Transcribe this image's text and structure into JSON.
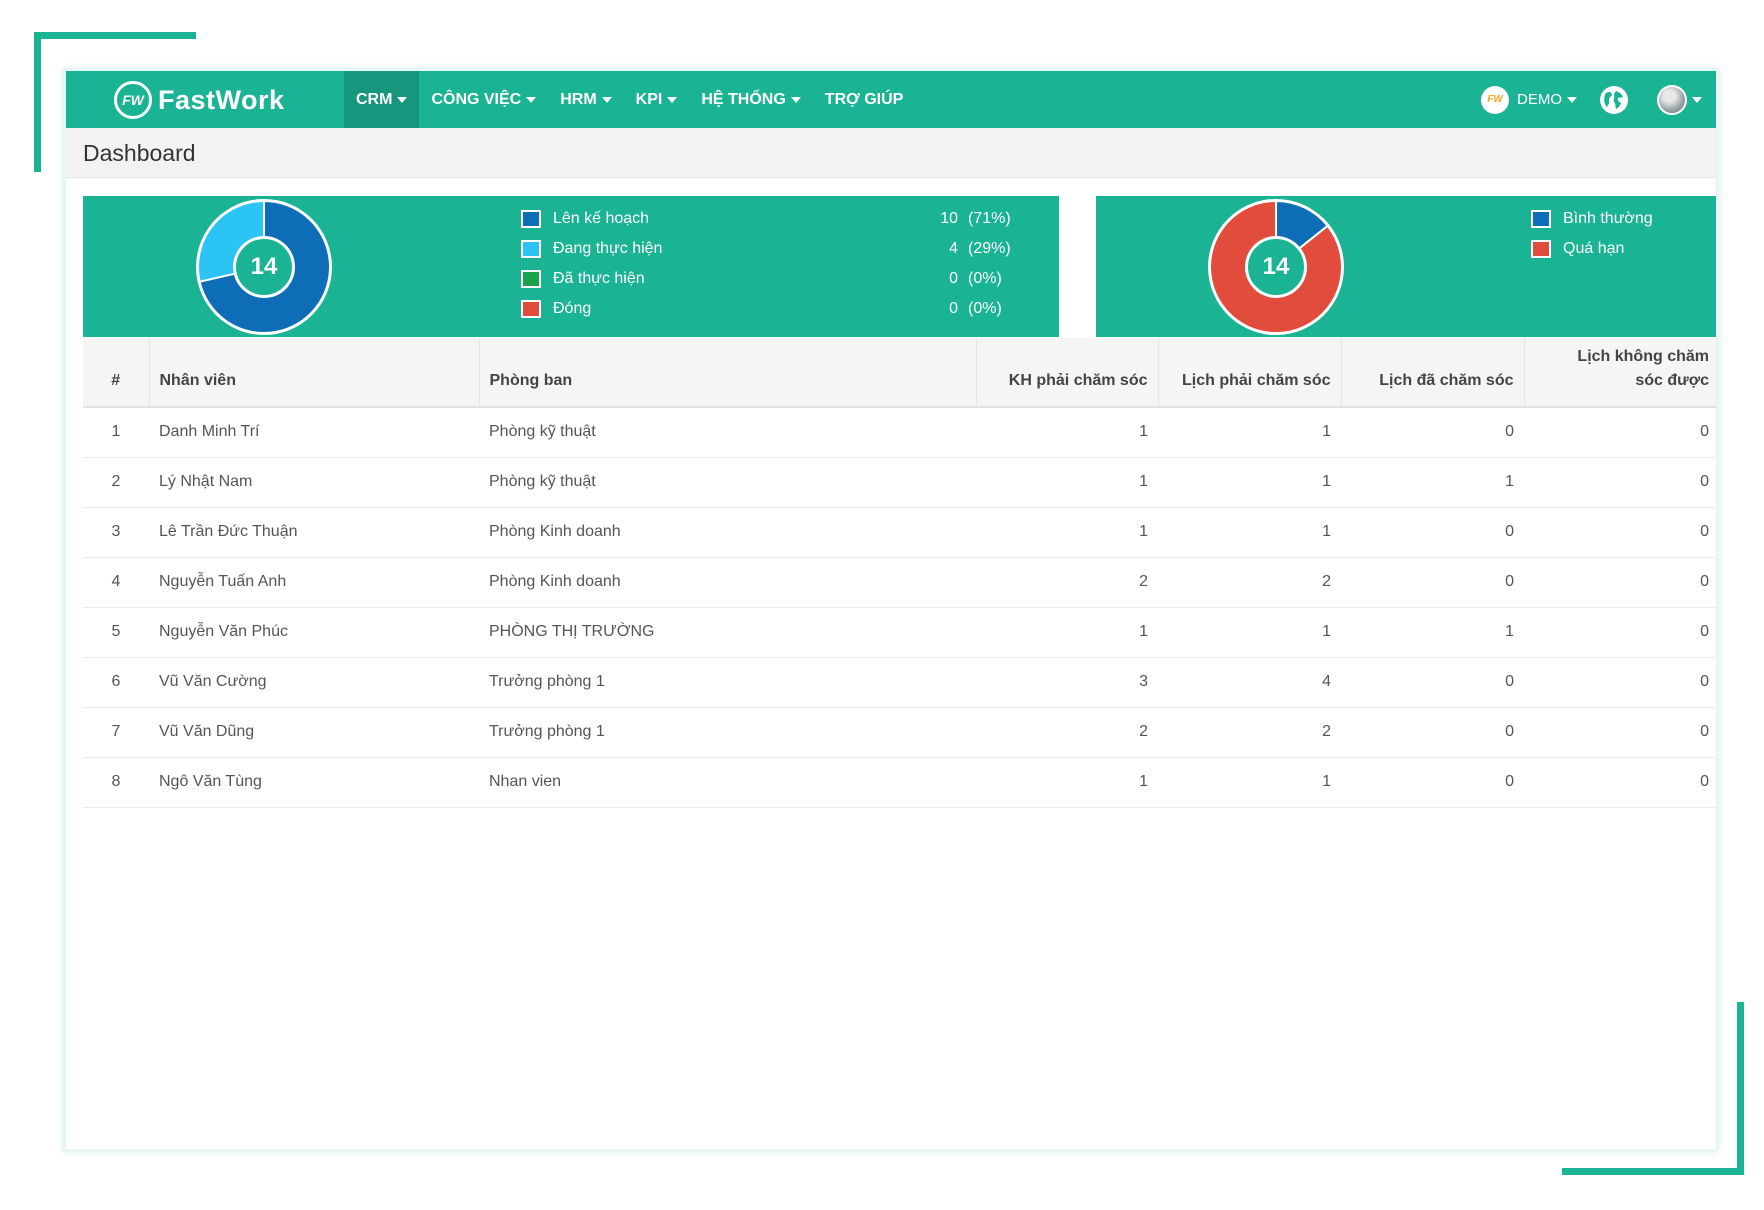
{
  "brand": {
    "logo_text": "FW",
    "name": "FastWork"
  },
  "menu": [
    {
      "label": "CRM",
      "dropdown": true,
      "active": true
    },
    {
      "label": "CÔNG VIỆC",
      "dropdown": true
    },
    {
      "label": "HRM",
      "dropdown": true
    },
    {
      "label": "KPI",
      "dropdown": true
    },
    {
      "label": "HỆ THỐNG",
      "dropdown": true
    },
    {
      "label": "TRỢ GIÚP",
      "dropdown": false
    }
  ],
  "company": {
    "logo_text": "FW",
    "name": "DEMO"
  },
  "icons": {
    "globe": "globe-icon",
    "avatar": "user-avatar",
    "caret": "caret-down-icon"
  },
  "page": {
    "title": "Dashboard"
  },
  "colors": {
    "brand_green": "#1ab394",
    "dark_blue": "#0d6db7",
    "light_blue": "#2cc4f4",
    "green": "#1aa34a",
    "red": "#e14c3d"
  },
  "status_chart": {
    "total": "14",
    "items": [
      {
        "label": "Lên kế hoạch",
        "count": "10",
        "pct": "(71%)",
        "value": 10,
        "color": "#0d6db7"
      },
      {
        "label": "Đang thực hiện",
        "count": "4",
        "pct": "(29%)",
        "value": 4,
        "color": "#2cc4f4"
      },
      {
        "label": "Đã thực hiện",
        "count": "0",
        "pct": "(0%)",
        "value": 0,
        "color": "#1aa34a"
      },
      {
        "label": "Đóng",
        "count": "0",
        "pct": "(0%)",
        "value": 0,
        "color": "#e14c3d"
      }
    ]
  },
  "deadline_chart": {
    "total": "14",
    "items": [
      {
        "label": "Bình thường",
        "value": 2,
        "color": "#0d6db7"
      },
      {
        "label": "Quá hạn",
        "value": 12,
        "color": "#e14c3d"
      }
    ]
  },
  "table": {
    "headers": {
      "idx": "#",
      "name": "Nhân viên",
      "dept": "Phòng ban",
      "kh": "KH phải chăm sóc",
      "lich": "Lịch phải chăm sóc",
      "done": "Lịch đã chăm sóc",
      "fail_line1": "Lịch không chăm",
      "fail_line2": "sóc được"
    },
    "rows": [
      {
        "idx": "1",
        "name": "Danh Minh Trí",
        "dept": "Phòng kỹ thuật",
        "kh": "1",
        "lich": "1",
        "done": "0",
        "fail": "0"
      },
      {
        "idx": "2",
        "name": "Lý Nhật Nam",
        "dept": "Phòng kỹ thuật",
        "kh": "1",
        "lich": "1",
        "done": "1",
        "fail": "0"
      },
      {
        "idx": "3",
        "name": "Lê Trần Đức Thuận",
        "dept": "Phòng Kinh doanh",
        "kh": "1",
        "lich": "1",
        "done": "0",
        "fail": "0"
      },
      {
        "idx": "4",
        "name": "Nguyễn Tuấn Anh",
        "dept": "Phòng Kinh doanh",
        "kh": "2",
        "lich": "2",
        "done": "0",
        "fail": "0"
      },
      {
        "idx": "5",
        "name": "Nguyễn Văn Phúc",
        "dept": "PHÒNG THỊ TRƯỜNG",
        "kh": "1",
        "lich": "1",
        "done": "1",
        "fail": "0"
      },
      {
        "idx": "6",
        "name": "Vũ Văn Cường",
        "dept": "Trưởng phòng 1",
        "kh": "3",
        "lich": "4",
        "done": "0",
        "fail": "0"
      },
      {
        "idx": "7",
        "name": "Vũ Văn Dũng",
        "dept": "Trưởng phòng 1",
        "kh": "2",
        "lich": "2",
        "done": "0",
        "fail": "0"
      },
      {
        "idx": "8",
        "name": "Ngô Văn Tùng",
        "dept": "Nhan vien",
        "kh": "1",
        "lich": "1",
        "done": "0",
        "fail": "0"
      }
    ]
  }
}
